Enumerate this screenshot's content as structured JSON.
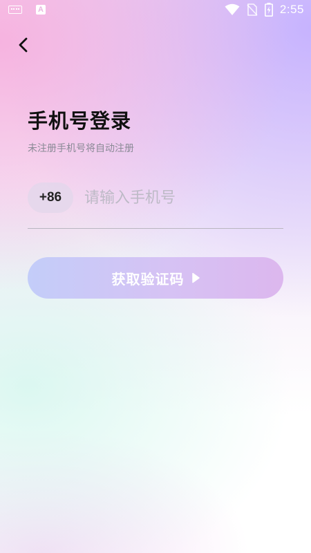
{
  "status_bar": {
    "keyboard_icon": "keyboard-icon",
    "input_method_letter": "A",
    "wifi_icon": "wifi-icon",
    "no_sim_icon": "no-sim-icon",
    "battery_icon": "battery-charging-icon",
    "time": "2:55"
  },
  "header": {
    "back_icon": "chevron-left-icon"
  },
  "login": {
    "title": "手机号登录",
    "subtitle": "未注册手机号将自动注册",
    "country_code": "+86",
    "phone_placeholder": "请输入手机号",
    "phone_value": "",
    "get_code_label": "获取验证码",
    "get_code_arrow_icon": "triangle-right-icon"
  },
  "colors": {
    "button_gradient_start": "#c3cdf9",
    "button_gradient_end": "#dcb7ee",
    "title": "#111111",
    "subtitle": "#8a8a96",
    "placeholder": "#bdbac6"
  }
}
